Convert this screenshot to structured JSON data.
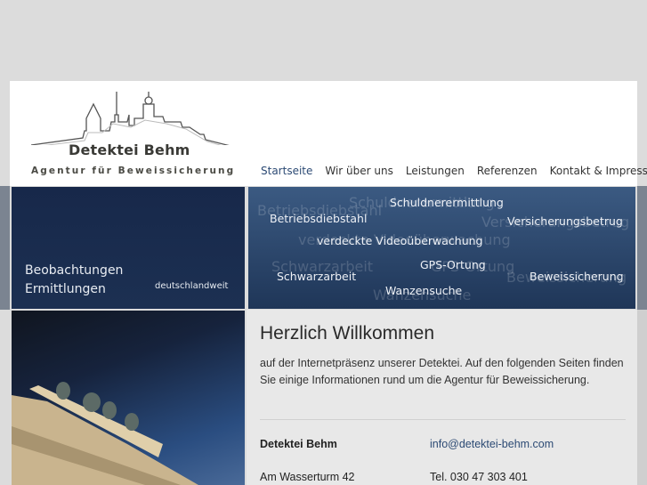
{
  "logo": {
    "name": "Detektei Behm",
    "tagline": "Agentur für Beweissicherung"
  },
  "nav": [
    {
      "label": "Startseite",
      "active": true
    },
    {
      "label": "Wir über uns"
    },
    {
      "label": "Leistungen"
    },
    {
      "label": "Referenzen"
    },
    {
      "label": "Kontakt & Impressum"
    }
  ],
  "banner_left": {
    "line1": "Beobachtungen",
    "line2": "Ermittlungen",
    "sub": "deutschlandweit"
  },
  "banner_right": {
    "services": [
      "Schuldnerermittlung",
      "Betriebsdiebstahl",
      "Versicherungsbetrug",
      "verdeckte Videoüberwachung",
      "GPS-Ortung",
      "Schwarzarbeit",
      "Beweissicherung",
      "Wanzensuche"
    ]
  },
  "content": {
    "title": "Herzlich Willkommen",
    "intro": "auf der Internetpräsenz unserer Detektei. Auf den folgenden Seiten finden Sie einige Informationen rund um die Agentur für Beweissicherung.",
    "company": "Detektei Behm",
    "email": "info@detektei-behm.com",
    "street": "Am Wasserturm 42",
    "phone": "Tel. 030 47 303 401"
  },
  "colors": {
    "accent": "#2c4a74",
    "banner_dark": "#1a2d4f"
  }
}
